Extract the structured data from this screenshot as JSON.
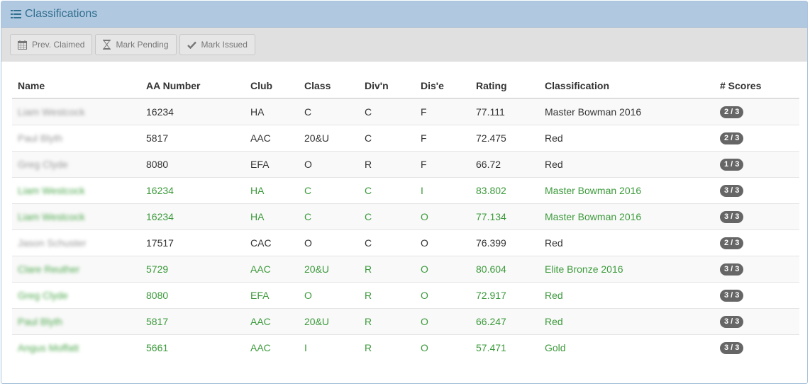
{
  "panel": {
    "title": "Classifications",
    "icon": "list-icon"
  },
  "toolbar": {
    "buttons": [
      {
        "label": "Prev. Claimed",
        "icon": "calendar-icon"
      },
      {
        "label": "Mark Pending",
        "icon": "hourglass-icon"
      },
      {
        "label": "Mark Issued",
        "icon": "check-icon"
      }
    ]
  },
  "table": {
    "headers": [
      "Name",
      "AA Number",
      "Club",
      "Class",
      "Div'n",
      "Dis'e",
      "Rating",
      "Classification",
      "# Scores"
    ],
    "rows": [
      {
        "name": "Liam Westcock",
        "aa": "16234",
        "club": "HA",
        "class": "C",
        "divn": "C",
        "dise": "F",
        "rating": "77.111",
        "classification": "Master Bowman 2016",
        "scores": "2 / 3",
        "status": "normal"
      },
      {
        "name": "Paul Blyth",
        "aa": "5817",
        "club": "AAC",
        "class": "20&U",
        "divn": "C",
        "dise": "F",
        "rating": "72.475",
        "classification": "Red",
        "scores": "2 / 3",
        "status": "normal"
      },
      {
        "name": "Greg Clyde",
        "aa": "8080",
        "club": "EFA",
        "class": "O",
        "divn": "R",
        "dise": "F",
        "rating": "66.72",
        "classification": "Red",
        "scores": "1 / 3",
        "status": "normal"
      },
      {
        "name": "Liam Westcock",
        "aa": "16234",
        "club": "HA",
        "class": "C",
        "divn": "C",
        "dise": "I",
        "rating": "83.802",
        "classification": "Master Bowman 2016",
        "scores": "3 / 3",
        "status": "complete"
      },
      {
        "name": "Liam Westcock",
        "aa": "16234",
        "club": "HA",
        "class": "C",
        "divn": "C",
        "dise": "O",
        "rating": "77.134",
        "classification": "Master Bowman 2016",
        "scores": "3 / 3",
        "status": "complete"
      },
      {
        "name": "Jason Schuster",
        "aa": "17517",
        "club": "CAC",
        "class": "O",
        "divn": "C",
        "dise": "O",
        "rating": "76.399",
        "classification": "Red",
        "scores": "2 / 3",
        "status": "normal"
      },
      {
        "name": "Clare Reuther",
        "aa": "5729",
        "club": "AAC",
        "class": "20&U",
        "divn": "R",
        "dise": "O",
        "rating": "80.604",
        "classification": "Elite Bronze 2016",
        "scores": "3 / 3",
        "status": "complete"
      },
      {
        "name": "Greg Clyde",
        "aa": "8080",
        "club": "EFA",
        "class": "O",
        "divn": "R",
        "dise": "O",
        "rating": "72.917",
        "classification": "Red",
        "scores": "3 / 3",
        "status": "complete"
      },
      {
        "name": "Paul Blyth",
        "aa": "5817",
        "club": "AAC",
        "class": "20&U",
        "divn": "R",
        "dise": "O",
        "rating": "66.247",
        "classification": "Red",
        "scores": "3 / 3",
        "status": "complete"
      },
      {
        "name": "Angus Moffatt",
        "aa": "5661",
        "club": "AAC",
        "class": "I",
        "divn": "R",
        "dise": "O",
        "rating": "57.471",
        "classification": "Gold",
        "scores": "3 / 3",
        "status": "complete"
      }
    ]
  },
  "colors": {
    "heading_bg": "#b1c8e1",
    "heading_text": "#31708f",
    "complete_text": "#3c9a3c",
    "badge_bg": "#666666"
  }
}
